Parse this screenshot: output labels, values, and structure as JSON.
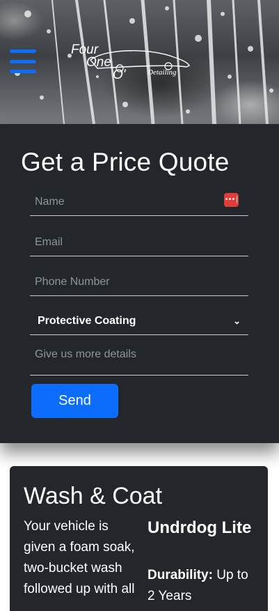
{
  "header": {
    "logo_text": {
      "line1": "Four",
      "line2": "One",
      "line3": "O'",
      "tag": "Detailing"
    }
  },
  "quote_form": {
    "title": "Get a Price Quote",
    "name_placeholder": "Name",
    "email_placeholder": "Email",
    "phone_placeholder": "Phone Number",
    "service_selected": "Protective Coating",
    "details_placeholder": "Give us more details",
    "send_label": "Send"
  },
  "service_card": {
    "title": "Wash & Coat",
    "description": "Your vehicle is given a foam soak, two-bucket wash followed up with all",
    "product_name": "Undrdog Lite",
    "durability_label": "Durability:",
    "durability_value": "Up to 2 Years"
  },
  "colors": {
    "accent": "#0d6efd",
    "panel": "#23272b",
    "password_manager": "#de3d3a"
  },
  "icons": [
    "hamburger-menu-icon",
    "password-manager-icon",
    "chevron-down-icon"
  ]
}
